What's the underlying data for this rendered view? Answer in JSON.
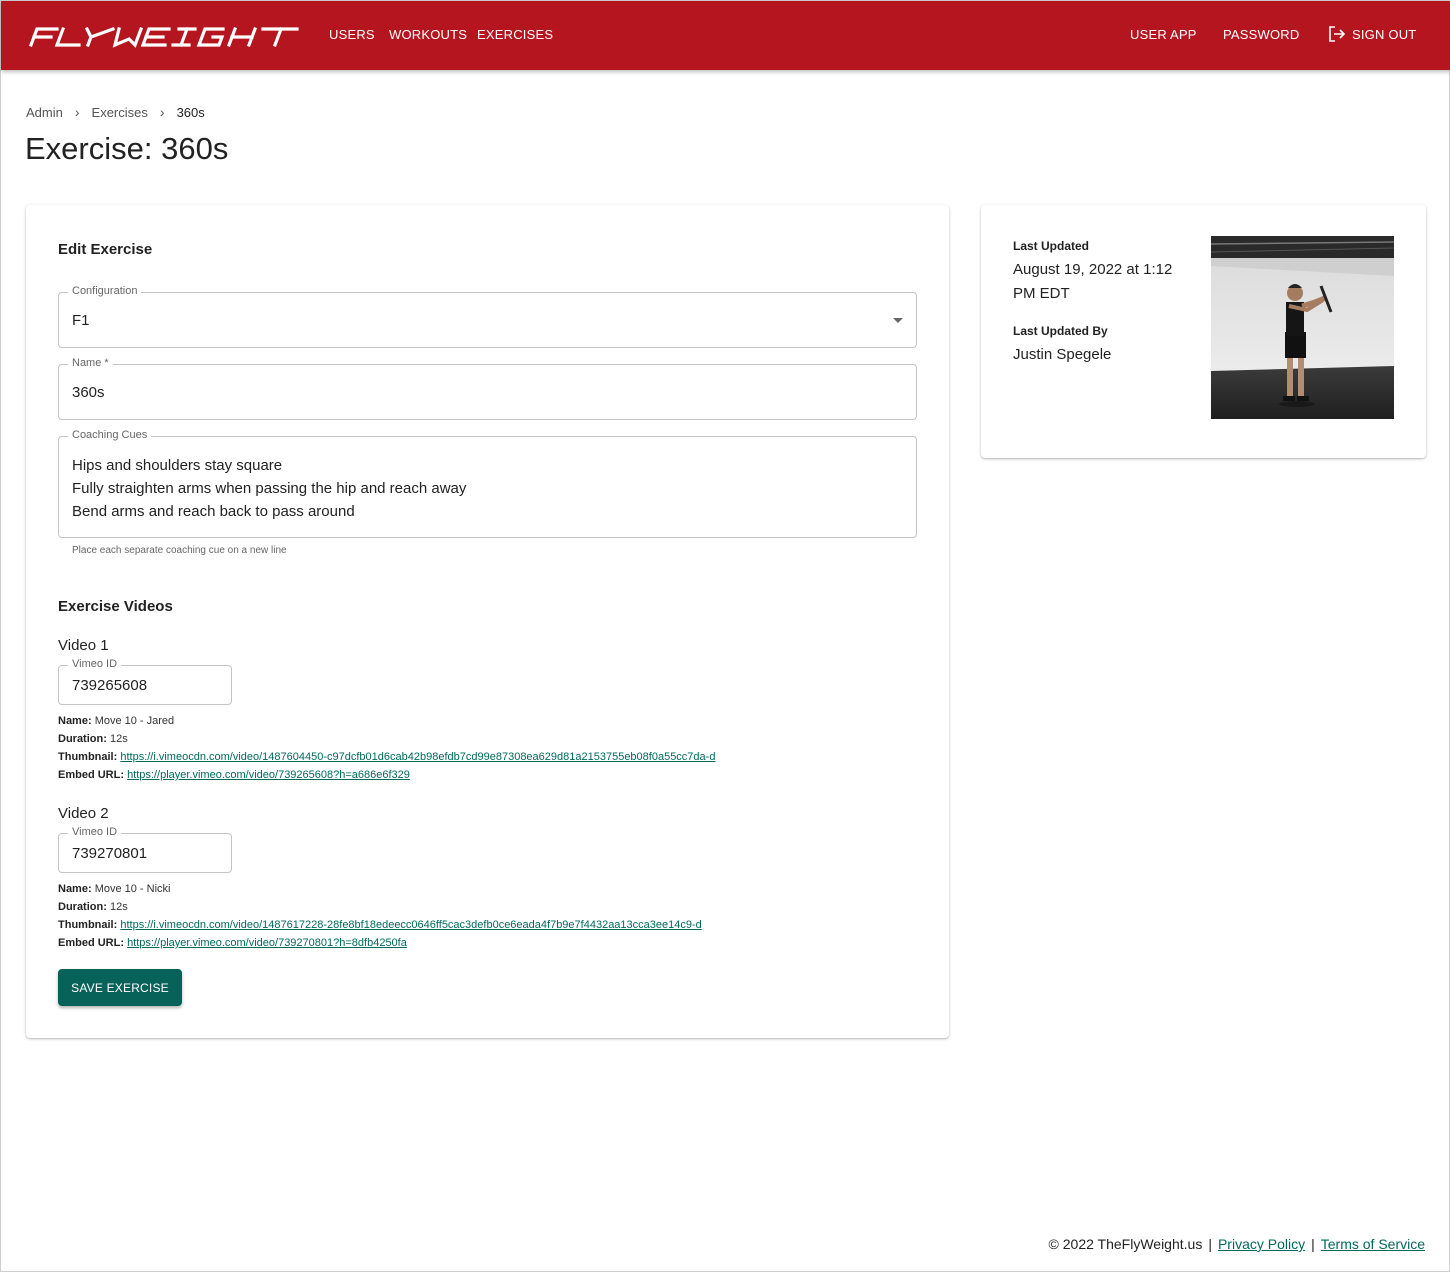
{
  "header": {
    "logo_text": "FLYWEIGHT",
    "nav": {
      "users": "USERS",
      "workouts": "WORKOUTS",
      "exercises": "EXERCISES"
    },
    "right": {
      "user_app": "USER APP",
      "password": "PASSWORD",
      "sign_out": "SIGN OUT"
    }
  },
  "breadcrumb": {
    "admin": "Admin",
    "exercises": "Exercises",
    "current": "360s"
  },
  "page_title": "Exercise: 360s",
  "edit": {
    "title": "Edit Exercise",
    "configuration": {
      "label": "Configuration",
      "value": "F1"
    },
    "name": {
      "label": "Name *",
      "value": "360s"
    },
    "coaching_cues": {
      "label": "Coaching Cues",
      "lines": [
        "Hips and shoulders stay square",
        "Fully straighten arms when passing the hip and reach away",
        "Bend arms and reach back to pass around"
      ],
      "helper": "Place each separate coaching cue on a new line"
    },
    "videos_title": "Exercise Videos",
    "videos": [
      {
        "heading": "Video 1",
        "vimeo_label": "Vimeo ID",
        "vimeo_id": "739265608",
        "name_label": "Name:",
        "name": "Move 10 - Jared",
        "duration_label": "Duration:",
        "duration": "12s",
        "thumbnail_label": "Thumbnail:",
        "thumbnail": "https://i.vimeocdn.com/video/1487604450-c97dcfb01d6cab42b98efdb7cd99e87308ea629d81a2153755eb08f0a55cc7da-d",
        "embed_label": "Embed URL:",
        "embed": "https://player.vimeo.com/video/739265608?h=a686e6f329"
      },
      {
        "heading": "Video 2",
        "vimeo_label": "Vimeo ID",
        "vimeo_id": "739270801",
        "name_label": "Name:",
        "name": "Move 10 - Nicki",
        "duration_label": "Duration:",
        "duration": "12s",
        "thumbnail_label": "Thumbnail:",
        "thumbnail": "https://i.vimeocdn.com/video/1487617228-28fe8bf18edeecc0646ff5cac3defb0ce6eada4f7b9e7f4432aa13cca3ee14c9-d",
        "embed_label": "Embed URL:",
        "embed": "https://player.vimeo.com/video/739270801?h=8dfb4250fa"
      }
    ],
    "save_label": "SAVE EXERCISE"
  },
  "side": {
    "last_updated_label": "Last Updated",
    "last_updated_line1": "August 19, 2022 at 1:12",
    "last_updated_line2": "PM EDT",
    "last_updated_by_label": "Last Updated By",
    "last_updated_by": "Justin Spegele"
  },
  "footer": {
    "copyright": "© 2022 TheFlyWeight.us",
    "sep": "|",
    "privacy": "Privacy Policy",
    "terms": "Terms of Service"
  },
  "colors": {
    "header": "#b5151f",
    "primary_button": "#07625a",
    "link": "#00695c"
  }
}
